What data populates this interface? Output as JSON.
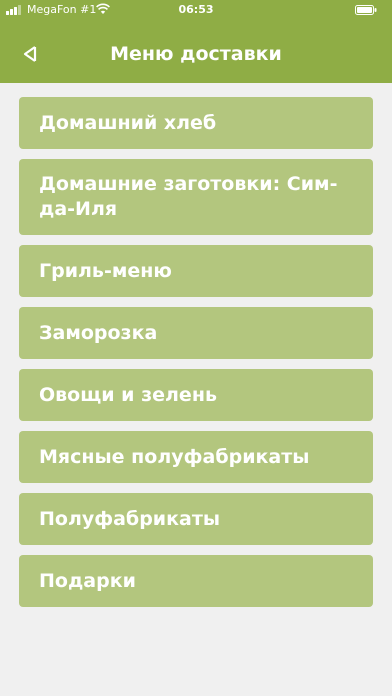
{
  "status_bar": {
    "carrier": "MegaFon #1",
    "time": "06:53"
  },
  "header": {
    "title": "Меню доставки",
    "back_icon": "back-arrow-icon"
  },
  "menu": {
    "items": [
      {
        "label": "Домашний хлеб"
      },
      {
        "label": "Домашние заготовки: Сим-да-Иля"
      },
      {
        "label": "Гриль-меню"
      },
      {
        "label": "Заморозка"
      },
      {
        "label": "Овощи и зелень"
      },
      {
        "label": "Мясные полуфабрикаты"
      },
      {
        "label": "Полуфабрикаты"
      },
      {
        "label": "Подарки"
      }
    ]
  },
  "colors": {
    "header_bg": "#8fad45",
    "item_bg": "#b3c67e",
    "page_bg": "#f0f0f0",
    "text": "#ffffff"
  }
}
